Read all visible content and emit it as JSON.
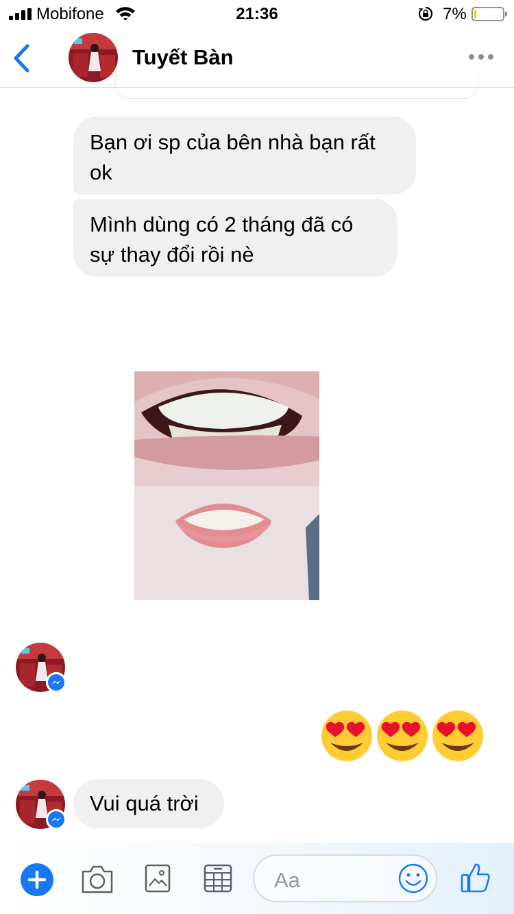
{
  "status_bar": {
    "carrier": "Mobifone",
    "time": "21:36",
    "battery_percent": "7%",
    "battery_level": 0.07,
    "icons": [
      "signal-icon",
      "wifi-icon",
      "rotation-lock-icon",
      "battery-icon"
    ]
  },
  "header": {
    "contact_name": "Tuyết Bàn",
    "icons": [
      "back-chevron-icon",
      "more-dots-icon"
    ]
  },
  "messages": [
    {
      "from": "contact",
      "type": "text",
      "text": "Bạn ơi sp của bên nhà bạn rất ok"
    },
    {
      "from": "contact",
      "type": "text",
      "text": "Mình dùng có 2 tháng đã có sự thay đổi rồi nè"
    },
    {
      "from": "contact",
      "type": "image"
    },
    {
      "from": "me",
      "type": "emoji",
      "icons": [
        "heart-eyes-emoji-icon",
        "heart-eyes-emoji-icon",
        "heart-eyes-emoji-icon"
      ]
    },
    {
      "from": "contact",
      "type": "text",
      "text": "Vui quá trời"
    }
  ],
  "composer": {
    "placeholder": "Aa",
    "icons": [
      "plus-icon",
      "camera-icon",
      "gallery-icon",
      "sticker-icon",
      "emoji-icon",
      "thumbs-up-icon"
    ]
  },
  "colors": {
    "accent": "#1877f2",
    "bubble_gray": "#f1f0f0",
    "battery_low": "#ffcc00"
  }
}
